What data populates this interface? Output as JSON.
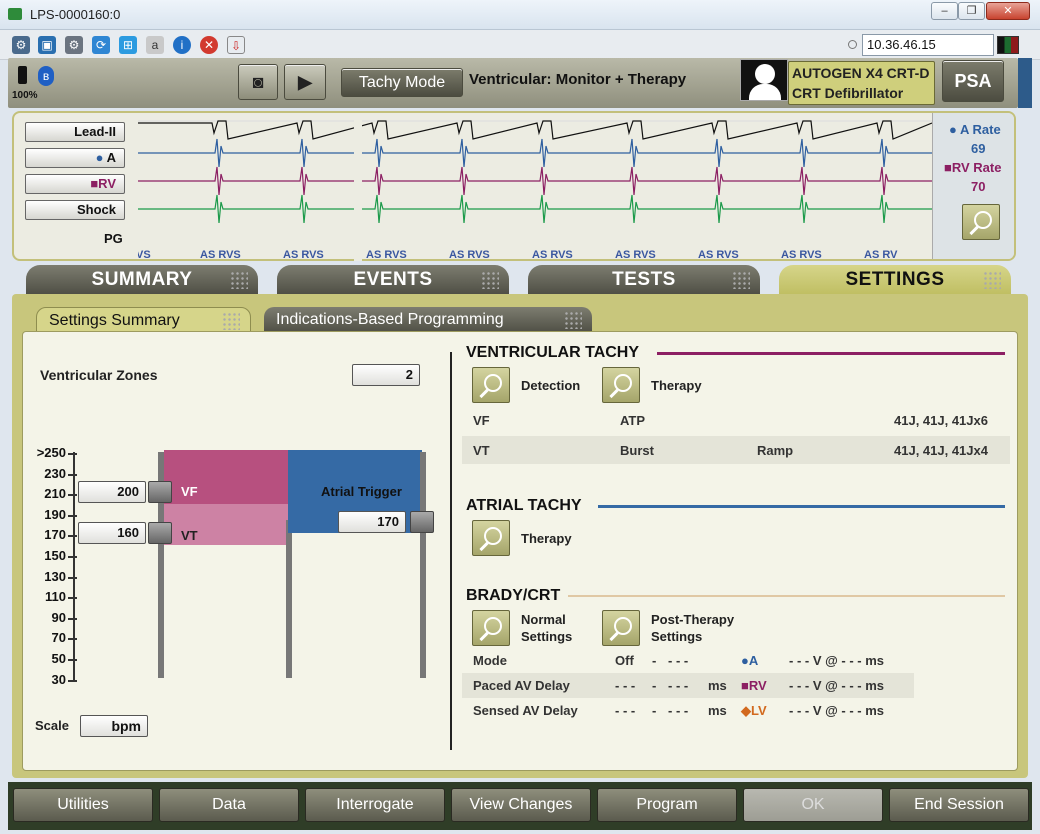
{
  "window": {
    "title": "LPS-0000160:0",
    "ip": "10.36.46.15",
    "minimize": "–",
    "restore": "❐",
    "close": "✕"
  },
  "status": {
    "battery": "100%",
    "tachy_mode": "Tachy Mode",
    "mode_text": "Ventricular: Monitor + Therapy",
    "device_line1": "AUTOGEN X4 CRT-D",
    "device_line2": "CRT Defibrillator",
    "psa": "PSA"
  },
  "ecg": {
    "leads": [
      "Lead-II",
      "A",
      "RV",
      "Shock"
    ],
    "pg": "PG",
    "a_rate_label": "A Rate",
    "a_rate": "69",
    "rv_rate_label": "RV Rate",
    "rv_rate": "70",
    "markers": [
      "VS",
      "AS RVS",
      "AS RVS",
      "AS RVS",
      "AS RVS",
      "AS RVS",
      "AS RVS",
      "AS RVS",
      "AS RVS",
      "AS RV"
    ],
    "colors": {
      "a": "#2e5fa0",
      "rv": "#8c1f63",
      "shock": "#1b9a4a"
    }
  },
  "tabs": [
    "SUMMARY",
    "EVENTS",
    "TESTS",
    "SETTINGS"
  ],
  "subtabs": [
    "Settings Summary",
    "Indications-Based Programming"
  ],
  "zones": {
    "label": "Ventricular Zones",
    "count": "2",
    "yticks": [
      ">250",
      "230",
      "210",
      "190",
      "170",
      "150",
      "130",
      "110",
      "90",
      "70",
      "50",
      "30"
    ],
    "vf_value": "200",
    "vf_label": "VF",
    "vt_value": "160",
    "vt_label": "VT",
    "atrial_label": "Atrial Trigger",
    "atrial_value": "170",
    "scale_label": "Scale",
    "scale_unit": "bpm"
  },
  "vt": {
    "heading": "VENTRICULAR TACHY",
    "detection": "Detection",
    "therapy": "Therapy",
    "rows": [
      [
        "VF",
        "ATP",
        "",
        "41J, 41J, 41Jx6"
      ],
      [
        "VT",
        "Burst",
        "Ramp",
        "41J, 41J, 41Jx4"
      ]
    ]
  },
  "at": {
    "heading": "ATRIAL TACHY",
    "therapy": "Therapy"
  },
  "brady": {
    "heading": "BRADY/CRT",
    "normal1": "Normal",
    "normal2": "Settings",
    "post1": "Post-Therapy",
    "post2": "Settings",
    "rows": [
      {
        "label": "Mode",
        "c1": "Off",
        "c2": "-",
        "c3": "- - -",
        "c4": "",
        "ch": "A",
        "chsym": "●",
        "v": "- - - V @ - - - ms"
      },
      {
        "label": "Paced AV Delay",
        "c1": "- - -",
        "c2": "-",
        "c3": "- - -",
        "c4": "ms",
        "ch": "RV",
        "chsym": "■",
        "v": "- - - V @ - - - ms"
      },
      {
        "label": "Sensed AV Delay",
        "c1": "- - -",
        "c2": "-",
        "c3": "- - -",
        "c4": "ms",
        "ch": "LV",
        "chsym": "◆",
        "v": "- - - V @ - - - ms"
      }
    ]
  },
  "bottom": [
    "Utilities",
    "Data",
    "Interrogate",
    "View Changes",
    "Program",
    "OK",
    "End Session"
  ]
}
